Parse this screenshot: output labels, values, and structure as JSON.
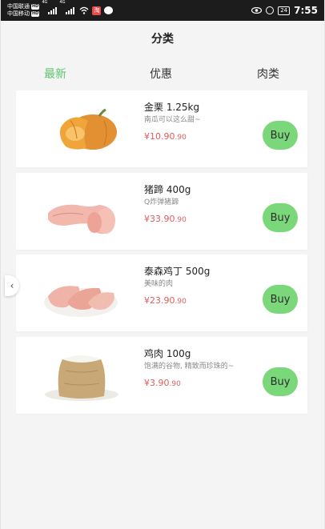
{
  "status_bar": {
    "carrier_1": "中国联通",
    "carrier_2": "中国移动",
    "hd": "HD",
    "network_1": "4G",
    "network_2": "4G",
    "app_badge": "淘",
    "battery": "24",
    "time": "7:55"
  },
  "header": {
    "title": "分类"
  },
  "tabs": [
    {
      "label": "最新",
      "active": true
    },
    {
      "label": "优惠",
      "active": false
    },
    {
      "label": "肉类",
      "active": false
    }
  ],
  "products": [
    {
      "title": "金栗 1.25kg",
      "desc": "南瓜可以这么甜~",
      "price_main": "¥10.90",
      "price_small": ".90",
      "buy_label": "Buy",
      "image": "pumpkin"
    },
    {
      "title": "猪蹄 400g",
      "desc": "Q炸弹猪蹄",
      "price_main": "¥33.90",
      "price_small": ".90",
      "buy_label": "Buy",
      "image": "pig-trotter"
    },
    {
      "title": "泰森鸡丁 500g",
      "desc": "美味的肉",
      "price_main": "¥23.90",
      "price_small": ".90",
      "buy_label": "Buy",
      "image": "chicken-breast"
    },
    {
      "title": "鸡肉 100g",
      "desc": "饱满的谷物, 精致而珍珠的~",
      "price_main": "¥3.90",
      "price_small": ".90",
      "buy_label": "Buy",
      "image": "rice-sack"
    }
  ],
  "back_handle": "‹",
  "colors": {
    "accent": "#5cc66e",
    "buy_button": "#7ad87a",
    "price": "#e05d5d"
  }
}
